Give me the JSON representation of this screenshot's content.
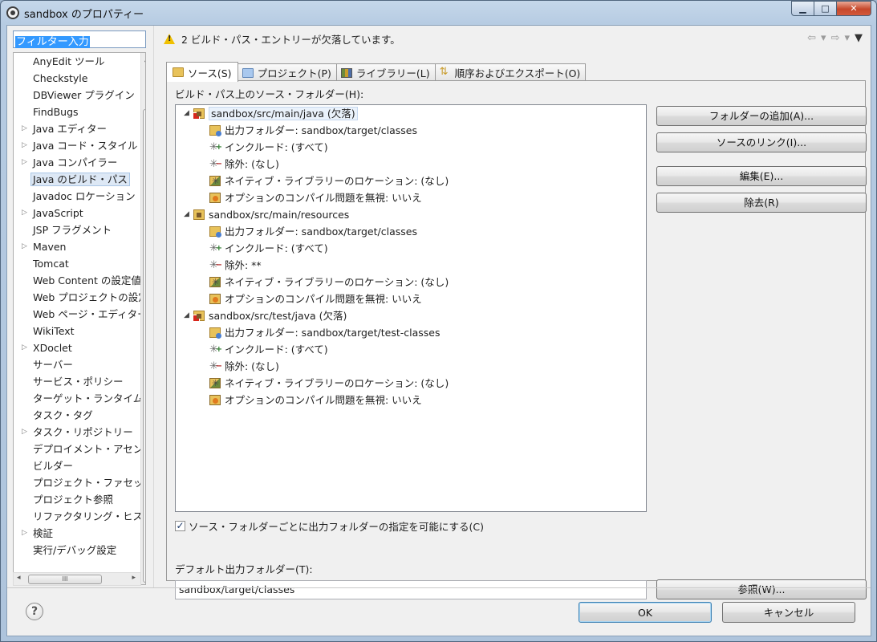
{
  "window": {
    "title": "sandbox のプロパティー",
    "min_glyph": "▁",
    "max_glyph": "□",
    "close_glyph": "✕"
  },
  "filter": {
    "text": "フィルター入力"
  },
  "left_tree": {
    "items": [
      {
        "label": "AnyEdit ツール",
        "expandable": false
      },
      {
        "label": "Checkstyle",
        "expandable": false
      },
      {
        "label": "DBViewer プラグイン",
        "expandable": false
      },
      {
        "label": "FindBugs",
        "expandable": false
      },
      {
        "label": "Java エディター",
        "expandable": true
      },
      {
        "label": "Java コード・スタイル",
        "expandable": true
      },
      {
        "label": "Java コンパイラー",
        "expandable": true
      },
      {
        "label": "Java のビルド・パス",
        "expandable": false,
        "selected": true
      },
      {
        "label": "Javadoc ロケーション",
        "expandable": false
      },
      {
        "label": "JavaScript",
        "expandable": true
      },
      {
        "label": "JSP フラグメント",
        "expandable": false
      },
      {
        "label": "Maven",
        "expandable": true
      },
      {
        "label": "Tomcat",
        "expandable": false
      },
      {
        "label": "Web Content の設定値",
        "expandable": false
      },
      {
        "label": "Web プロジェクトの設定",
        "expandable": false
      },
      {
        "label": "Web ページ・エディター",
        "expandable": false
      },
      {
        "label": "WikiText",
        "expandable": false
      },
      {
        "label": "XDoclet",
        "expandable": true
      },
      {
        "label": "サーバー",
        "expandable": false
      },
      {
        "label": "サービス・ポリシー",
        "expandable": false
      },
      {
        "label": "ターゲット・ランタイム",
        "expandable": false
      },
      {
        "label": "タスク・タグ",
        "expandable": false
      },
      {
        "label": "タスク・リポジトリー",
        "expandable": true
      },
      {
        "label": "デプロイメント・アセンブリー",
        "expandable": false
      },
      {
        "label": "ビルダー",
        "expandable": false
      },
      {
        "label": "プロジェクト・ファセット",
        "expandable": false
      },
      {
        "label": "プロジェクト参照",
        "expandable": false
      },
      {
        "label": "リファクタリング・ヒストリー",
        "expandable": false
      },
      {
        "label": "検証",
        "expandable": true
      },
      {
        "label": "実行/デバッグ設定",
        "expandable": false
      }
    ],
    "hscroll_thumb_glyph": "III"
  },
  "message": {
    "text": "2 ビルド・パス・エントリーが欠落しています。"
  },
  "nav": {
    "back": "⇦",
    "back_menu": "▾",
    "forward": "⇨",
    "forward_menu": "▾",
    "view_menu": "▼"
  },
  "tabs": [
    {
      "label": "ソース(S)",
      "icon": "source-folder-icon",
      "active": true
    },
    {
      "label": "プロジェクト(P)",
      "icon": "project-folder-icon",
      "active": false
    },
    {
      "label": "ライブラリー(L)",
      "icon": "library-icon",
      "active": false
    },
    {
      "label": "順序およびエクスポート(O)",
      "icon": "order-export-icon",
      "active": false
    }
  ],
  "source_page": {
    "section_label": "ビルド・パス上のソース・フォルダー(H):",
    "folders": [
      {
        "path": "sandbox/src/main/java (欠落)",
        "missing": true,
        "children": [
          {
            "type": "output",
            "text": "出力フォルダー: sandbox/target/classes"
          },
          {
            "type": "include",
            "text": "インクルード: (すべて)"
          },
          {
            "type": "exclude",
            "text": "除外: (なし)"
          },
          {
            "type": "native",
            "text": "ネイティブ・ライブラリーのロケーション: (なし)"
          },
          {
            "type": "ignore",
            "text": "オプションのコンパイル問題を無視: いいえ"
          }
        ]
      },
      {
        "path": "sandbox/src/main/resources",
        "missing": false,
        "children": [
          {
            "type": "output",
            "text": "出力フォルダー: sandbox/target/classes"
          },
          {
            "type": "include",
            "text": "インクルード: (すべて)"
          },
          {
            "type": "exclude",
            "text": "除外: **"
          },
          {
            "type": "native",
            "text": "ネイティブ・ライブラリーのロケーション: (なし)"
          },
          {
            "type": "ignore",
            "text": "オプションのコンパイル問題を無視: いいえ"
          }
        ]
      },
      {
        "path": "sandbox/src/test/java (欠落)",
        "missing": true,
        "children": [
          {
            "type": "output",
            "text": "出力フォルダー: sandbox/target/test-classes"
          },
          {
            "type": "include",
            "text": "インクルード: (すべて)"
          },
          {
            "type": "exclude",
            "text": "除外: (なし)"
          },
          {
            "type": "native",
            "text": "ネイティブ・ライブラリーのロケーション: (なし)"
          },
          {
            "type": "ignore",
            "text": "オプションのコンパイル問題を無視: いいえ"
          }
        ]
      }
    ],
    "buttons": {
      "add_folder": "フォルダーの追加(A)...",
      "link_source": "ソースのリンク(I)...",
      "edit": "編集(E)...",
      "remove": "除去(R)",
      "browse": "参照(W)..."
    },
    "allow_output_checkbox": {
      "label": "ソース・フォルダーごとに出力フォルダーの指定を可能にする(C)",
      "checked": true,
      "glyph": "✓"
    },
    "default_output_label": "デフォルト出力フォルダー(T):",
    "default_output_value": "sandbox/target/classes"
  },
  "footer": {
    "help_glyph": "?",
    "ok": "OK",
    "cancel": "キャンセル"
  }
}
